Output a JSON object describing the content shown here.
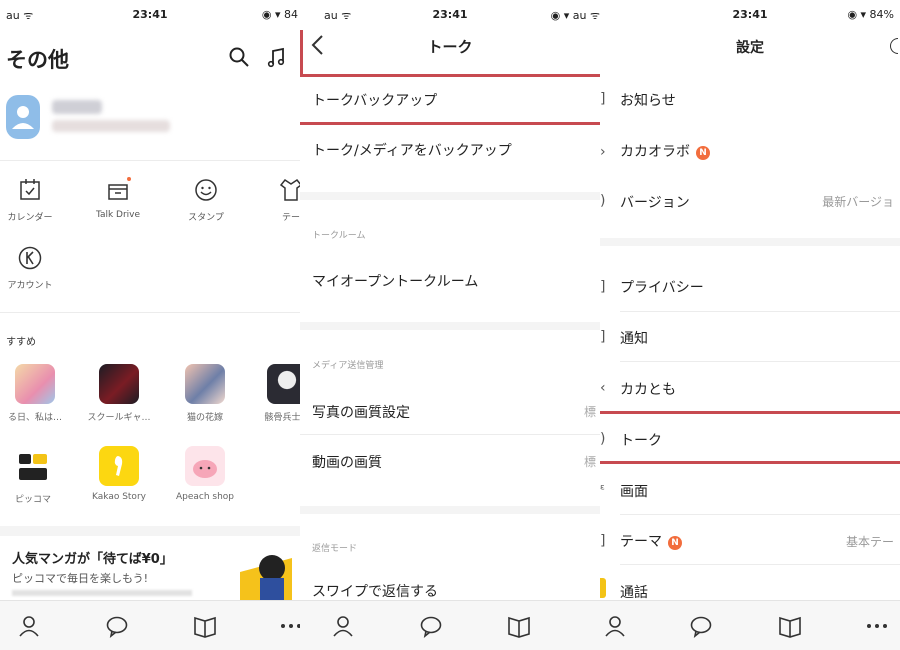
{
  "status_bars": [
    {
      "carrier": "au ᯤ",
      "time": "23:41",
      "right": "◉ ▾ 84"
    },
    {
      "carrier": "au ᯤ",
      "time": "23:41",
      "right": "◉ ▾ au ᯤ"
    },
    {
      "carrier": "",
      "time": "23:41",
      "right": "◉ ▾ 84%"
    }
  ],
  "more": {
    "title": "その他",
    "grid": [
      {
        "label": "カレンダー",
        "icon": "calendar-icon"
      },
      {
        "label": "Talk Drive",
        "icon": "drive-icon"
      },
      {
        "label": "スタンプ",
        "icon": "emoticon-icon"
      },
      {
        "label": "テー",
        "icon": "theme-icon"
      },
      {
        "label": "アカウント",
        "icon": "kakao-account-icon"
      }
    ],
    "recommend_label": "すすめ",
    "apps": [
      {
        "label": "る日、私は…"
      },
      {
        "label": "スクールギャ…"
      },
      {
        "label": "猫の花嫁"
      },
      {
        "label": "骸骨兵士は"
      },
      {
        "label": "ピッコマ"
      },
      {
        "label": "Kakao Story"
      },
      {
        "label": "Apeach shop"
      }
    ],
    "banner_title": "人気マンガが「待てば¥0」",
    "banner_subtitle": "ピッコマで毎日を楽しもう!"
  },
  "talk": {
    "title": "トーク",
    "row_backup": "トークバックアップ",
    "row_backup_media": "トーク/メディアをバックアップ",
    "section_room": "トークルーム",
    "row_open_room": "マイオープントークルーム",
    "section_media": "メディア送信管理",
    "row_photo_quality": "写真の画質設定",
    "photo_value": "標",
    "row_video_quality": "動画の画質",
    "video_value": "標",
    "section_reply": "返信モード",
    "row_swipe": "スワイプで返信する"
  },
  "settings": {
    "title": "設定",
    "rows": {
      "notice": "お知らせ",
      "kakaolab": "カカオラボ",
      "version": "バージョン",
      "version_value": "最新バージョ",
      "privacy": "プライバシー",
      "notify": "通知",
      "friends": "カカとも",
      "talk": "トーク",
      "screen": "画面",
      "theme": "テーマ",
      "theme_value": "基本テー",
      "call": "通話"
    },
    "new_badge": "N"
  },
  "colors": {
    "highlight": "#c74a50",
    "badge": "#f26d3d"
  }
}
